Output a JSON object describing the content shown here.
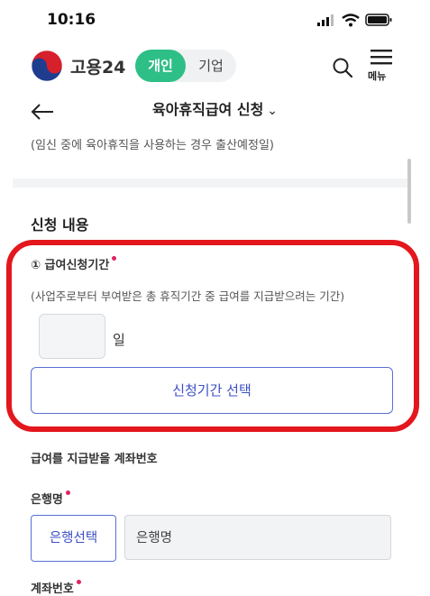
{
  "status_bar": {
    "time": "10:16"
  },
  "header": {
    "brand": "고용24",
    "toggle_personal": "개인",
    "toggle_business": "기업",
    "menu_label": "메뉴"
  },
  "title_bar": {
    "title": "육아휴직급여 신청",
    "chevron": "⌄"
  },
  "prev_note": "(임신 중에 육아휴직을 사용하는 경우 출산예정일)",
  "section": {
    "title": "신청 내용",
    "period_label": "① 급여신청기간",
    "period_desc": "(사업주로부터 부여받은 총 휴직기간 중 급여를 지급받으려는 기간)",
    "days_value": "",
    "days_unit": "일",
    "select_period_button": "신청기간 선택"
  },
  "account": {
    "title": "급여를 지급받을 계좌번호",
    "bank_label": "은행명",
    "bank_select_button": "은행선택",
    "bank_field_placeholder": "은행명",
    "account_no_label": "계좌번호"
  },
  "colors": {
    "accent_green": "#2ebf87",
    "primary_blue": "#3c4fc4",
    "highlight_red": "#e3171d",
    "required_dot": "#e0245e"
  },
  "icons": [
    "signal-icon",
    "wifi-icon",
    "battery-icon",
    "taegeuk-logo-icon",
    "search-icon",
    "hamburger-menu-icon",
    "back-arrow-icon",
    "chevron-down-icon"
  ]
}
